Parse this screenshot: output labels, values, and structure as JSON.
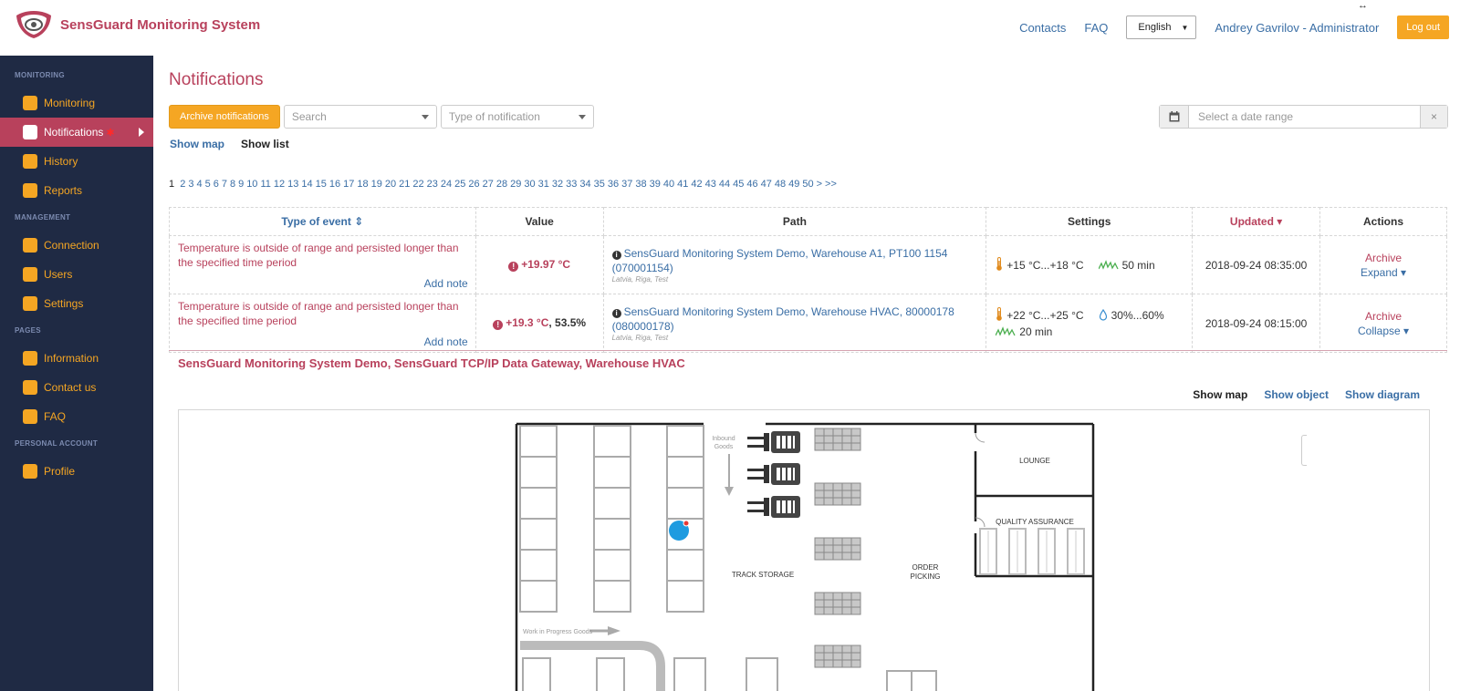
{
  "app": {
    "title": "SensGuard Monitoring System",
    "resize_glyph": "↔"
  },
  "header": {
    "contacts": "Contacts",
    "faq": "FAQ",
    "language": "English",
    "user": "Andrey Gavrilov - Administrator",
    "logout": "Log out"
  },
  "sidebar": {
    "sections": [
      {
        "title": "MONITORING",
        "items": [
          {
            "label": "Monitoring"
          },
          {
            "label": "Notifications",
            "active": true
          },
          {
            "label": "History"
          },
          {
            "label": "Reports"
          }
        ]
      },
      {
        "title": "MANAGEMENT",
        "items": [
          {
            "label": "Connection"
          },
          {
            "label": "Users"
          },
          {
            "label": "Settings"
          }
        ]
      },
      {
        "title": "PAGES",
        "items": [
          {
            "label": "Information"
          },
          {
            "label": "Contact us"
          },
          {
            "label": "FAQ"
          }
        ]
      },
      {
        "title": "PERSONAL ACCOUNT",
        "items": [
          {
            "label": "Profile"
          }
        ]
      }
    ],
    "active_marker": "✱"
  },
  "main": {
    "title": "Notifications",
    "archive_button": "Archive notifications",
    "search_placeholder": "Search",
    "type_placeholder": "Type of notification",
    "date_placeholder": "Select a date range",
    "date_clear": "×",
    "show_map": "Show map",
    "show_list": "Show list",
    "pager": {
      "current": "1",
      "pages": [
        "2",
        "3",
        "4",
        "5",
        "6",
        "7",
        "8",
        "9",
        "10",
        "11",
        "12",
        "13",
        "14",
        "15",
        "16",
        "17",
        "18",
        "19",
        "20",
        "21",
        "22",
        "23",
        "24",
        "25",
        "26",
        "27",
        "28",
        "29",
        "30",
        "31",
        "32",
        "33",
        "34",
        "35",
        "36",
        "37",
        "38",
        "39",
        "40",
        "41",
        "42",
        "43",
        "44",
        "45",
        "46",
        "47",
        "48",
        "49",
        "50"
      ],
      "next": ">",
      "last": ">>"
    }
  },
  "table": {
    "headers": {
      "type": "Type of event ⇕",
      "value": "Value",
      "path": "Path",
      "settings": "Settings",
      "updated": "Updated ▾",
      "actions": "Actions"
    },
    "rows": [
      {
        "event": "Temperature is outside of range and persisted longer than the specified time period",
        "add_note": "Add note",
        "value_main": "+19.97 °C",
        "value_extra": "",
        "path": "SensGuard Monitoring System Demo, Warehouse A1, PT100 1154 (070001154)",
        "location": "Latvia, Riga, Test",
        "temp_range": "+15 °C...+18 °C",
        "humidity_range": "",
        "duration": "50 min",
        "updated": "2018-09-24 08:35:00",
        "archive": "Archive",
        "toggle": "Expand ▾"
      },
      {
        "event": "Temperature is outside of range and persisted longer than the specified time period",
        "add_note": "Add note",
        "value_main": "+19.3 °C",
        "value_extra": ", 53.5%",
        "path": "SensGuard Monitoring System Demo, Warehouse HVAC, 80000178 (080000178)",
        "location": "Latvia, Riga, Test",
        "temp_range": "+22 °C...+25 °C",
        "humidity_range": "30%...60%",
        "duration": "20 min",
        "updated": "2018-09-24 08:15:00",
        "archive": "Archive",
        "toggle": "Collapse ▾"
      }
    ]
  },
  "detail": {
    "title": "SensGuard Monitoring System Demo, SensGuard TCP/IP Data Gateway, Warehouse HVAC",
    "show_map": "Show map",
    "show_object": "Show object",
    "show_diagram": "Show diagram"
  },
  "floorplan": {
    "inbound_line1": "Inbound",
    "inbound_line2": "Goods",
    "lounge": "LOUNGE",
    "qa": "QUALITY ASSURANCE",
    "track_storage": "TRACK STORAGE",
    "order_line1": "ORDER",
    "order_line2": "PICKING",
    "wip": "Work in Progress Goods",
    "sensor_color": "#1e9be0"
  },
  "colors": {
    "brand": "#b8415c",
    "accent": "#f5a623",
    "sidebar": "#1f2a44",
    "link": "#3a6ea5"
  }
}
